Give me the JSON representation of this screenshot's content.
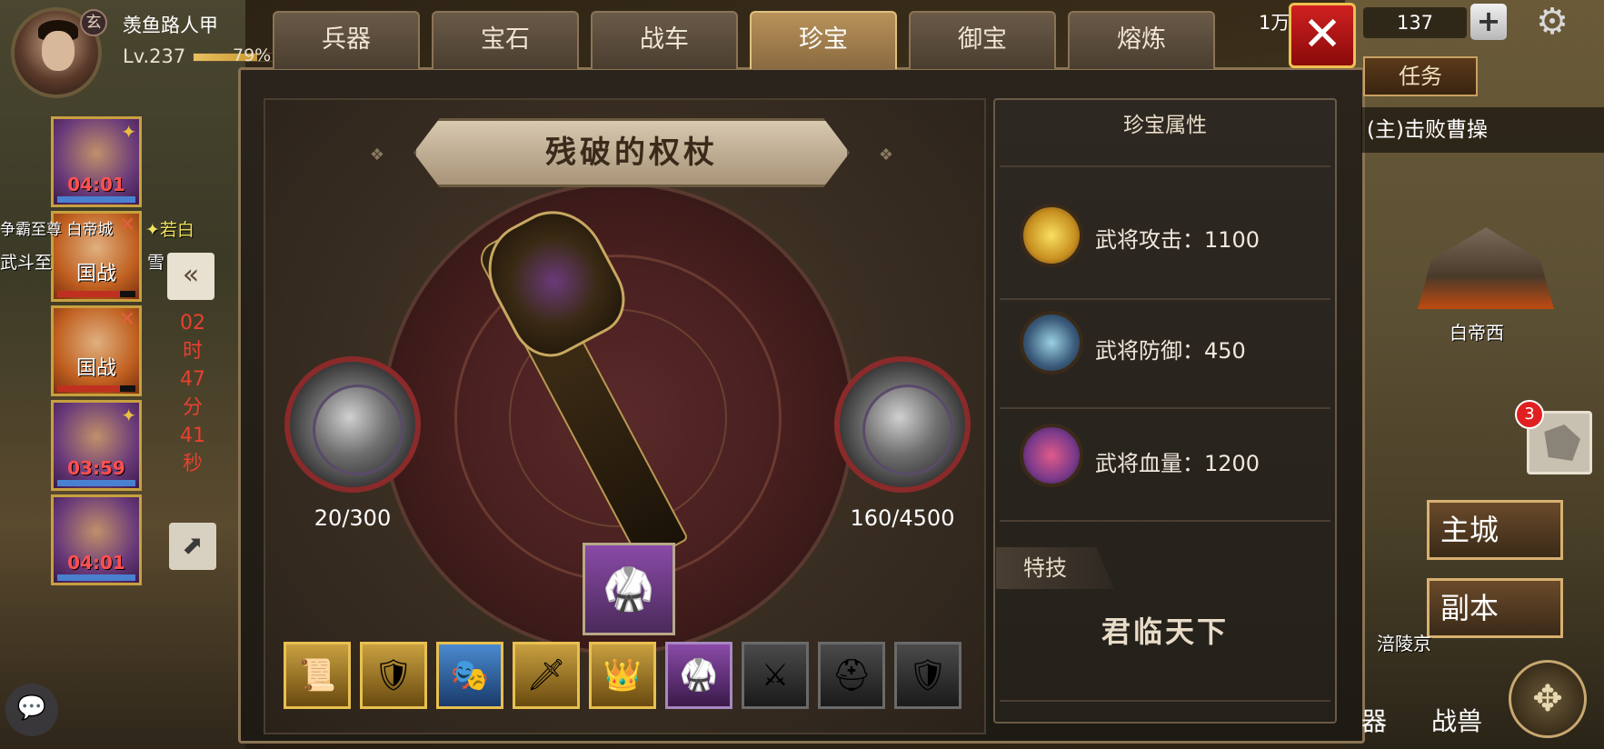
{
  "player": {
    "badge": "玄",
    "name": "羡鱼路人甲",
    "level": "Lv.237",
    "exp_pct": "79%",
    "exp_fraction": 0.79
  },
  "heroes": [
    {
      "timer": "04:01",
      "type": "timer",
      "color": "purple"
    },
    {
      "label": "国战",
      "type": "war",
      "color": "orange"
    },
    {
      "label": "国战",
      "type": "war",
      "color": "orange"
    },
    {
      "timer": "03:59",
      "type": "timer",
      "color": "purple"
    },
    {
      "timer": "04:01",
      "type": "timer",
      "color": "purple"
    }
  ],
  "side_texts": {
    "left1": "争霸至尊 白帝城",
    "left2": "武斗至",
    "right1": "✦若白",
    "right2": "雪"
  },
  "countdown": [
    "02",
    "时",
    "47",
    "分",
    "41",
    "秒"
  ],
  "collapse_glyph": "«",
  "arrow_glyph": "⬈",
  "chat_glyph": "💬",
  "tabs": [
    "兵器",
    "宝石",
    "战车",
    "珍宝",
    "御宝",
    "熔炼"
  ],
  "active_tab": "珍宝",
  "currency": {
    "amount1": "1万",
    "amount2": "137",
    "close_glyph": "✕",
    "plus_glyph": "+",
    "gear_glyph": "⚙"
  },
  "map": {
    "task_label": "任务",
    "task_text": "(主)击败曹操",
    "city1": "白帝西",
    "badge_count": "3",
    "main_city_btn": "主城",
    "dungeon_btn": "副本",
    "city2": "涪陵京",
    "bottom1": "器",
    "bottom2": "战兽",
    "compass_glyph": "✥"
  },
  "treasure": {
    "name": "残破的权杖",
    "left_value": "20/300",
    "right_value": "160/4500",
    "ornament": "❖",
    "items": [
      "📜",
      "🛡",
      "🎭",
      "🗡",
      "👑",
      "🥋",
      "⚔",
      "⛑",
      "🛡"
    ],
    "item_colors": [
      "gold",
      "gold",
      "blue",
      "gold",
      "gold",
      "purple",
      "gray",
      "gray",
      "gray"
    ],
    "equipped_glyph": "🥋"
  },
  "attributes": {
    "title": "珍宝属性",
    "rows": [
      {
        "text": "武将攻击：1100",
        "icon": "sword-slash-icon"
      },
      {
        "text": "武将防御：450",
        "icon": "shield-icon"
      },
      {
        "text": "武将血量：1200",
        "icon": "heart-icon"
      }
    ],
    "skill_label": "特技",
    "skill_name": "君临天下"
  }
}
